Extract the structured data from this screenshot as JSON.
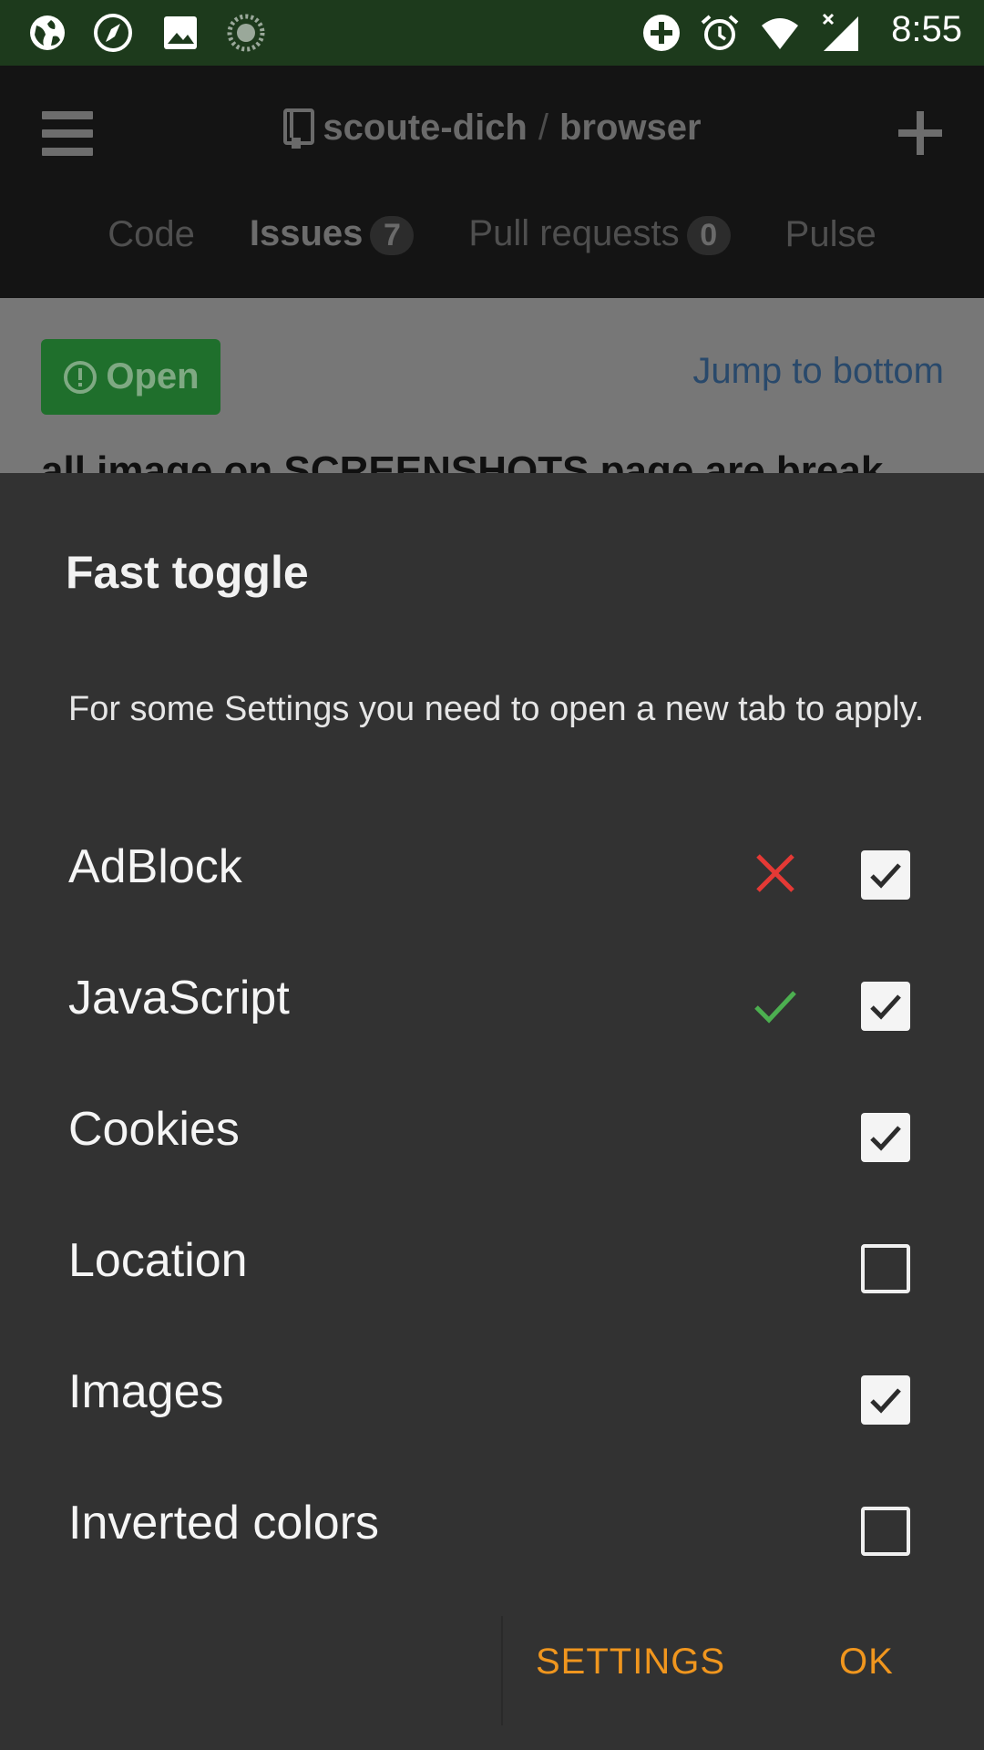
{
  "status_bar": {
    "time": "8:55",
    "left_icons": [
      "globe-icon",
      "compass-icon",
      "image-icon",
      "sync-icon"
    ],
    "right_icons": [
      "add-circle-icon",
      "alarm-icon",
      "wifi-icon",
      "signal-icon"
    ]
  },
  "app_header": {
    "repo_owner": "scoute-dich",
    "repo_sep": "/",
    "repo_name": "browser",
    "tabs": [
      {
        "label": "Code"
      },
      {
        "label": "Issues",
        "count": "7"
      },
      {
        "label": "Pull requests",
        "count": "0"
      },
      {
        "label": "Pulse"
      }
    ]
  },
  "page": {
    "open_badge": "Open",
    "jump_link": "Jump to bottom",
    "issue_title": "all image on SCREENSHOTS page are break"
  },
  "dialog": {
    "title": "Fast toggle",
    "message": "For some Settings you need to open a new tab to apply.",
    "options": [
      {
        "label": "AdBlock",
        "checked": true,
        "status": "cross"
      },
      {
        "label": "JavaScript",
        "checked": true,
        "status": "check"
      },
      {
        "label": "Cookies",
        "checked": true,
        "status": ""
      },
      {
        "label": "Location",
        "checked": false,
        "status": ""
      },
      {
        "label": "Images",
        "checked": true,
        "status": ""
      },
      {
        "label": "Inverted colors",
        "checked": false,
        "status": ""
      }
    ],
    "settings_button": "SETTINGS",
    "ok_button": "OK"
  },
  "colors": {
    "status_bar": "#1d3a1c",
    "dialog_bg": "#323232",
    "accent": "#f0961e",
    "cross": "#e53935",
    "check": "#4caf50"
  }
}
